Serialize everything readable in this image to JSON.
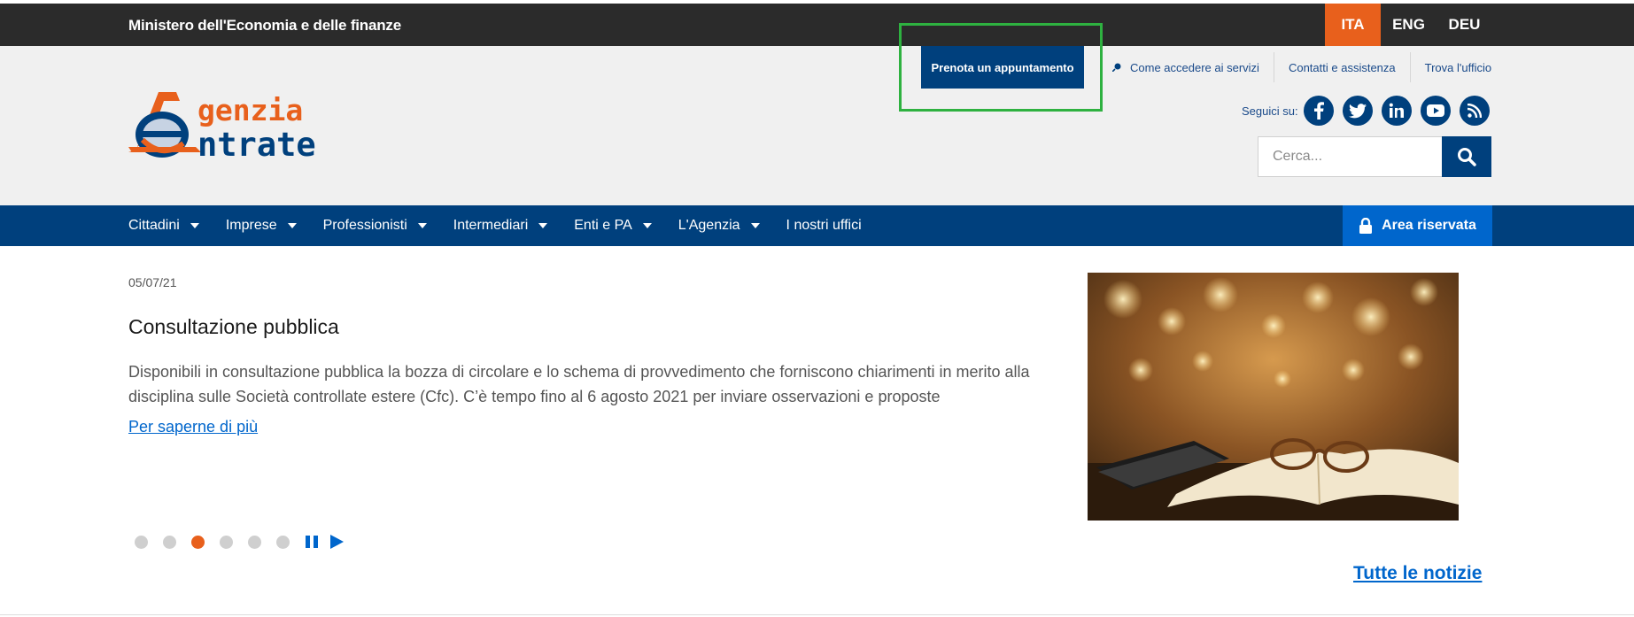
{
  "topbar": {
    "ministry": "Ministero dell'Economia e delle finanze",
    "languages": [
      {
        "label": "ITA",
        "active": true
      },
      {
        "label": "ENG",
        "active": false
      },
      {
        "label": "DEU",
        "active": false
      }
    ]
  },
  "header": {
    "logo": {
      "line1": "genzia",
      "line2": "ntrate",
      "icon": "agenzia-entrate-logo"
    },
    "prenota_label": "Prenota un appuntamento",
    "links": [
      {
        "label": "Come accedere ai servizi",
        "icon": "pin-icon"
      },
      {
        "label": "Contatti e assistenza"
      },
      {
        "label": "Trova l'ufficio"
      }
    ],
    "seguici": "Seguici su:",
    "socials": [
      "facebook-icon",
      "twitter-icon",
      "linkedin-icon",
      "youtube-icon",
      "rss-icon"
    ],
    "search_placeholder": "Cerca..."
  },
  "nav": {
    "items": [
      {
        "label": "Cittadini",
        "dropdown": true
      },
      {
        "label": "Imprese",
        "dropdown": true
      },
      {
        "label": "Professionisti",
        "dropdown": true
      },
      {
        "label": "Intermediari",
        "dropdown": true
      },
      {
        "label": "Enti e PA",
        "dropdown": true
      },
      {
        "label": "L'Agenzia",
        "dropdown": true
      },
      {
        "label": "I nostri uffici",
        "dropdown": false
      }
    ],
    "area_riservata": "Area riservata"
  },
  "news": {
    "date": "05/07/21",
    "title": "Consultazione pubblica",
    "description": "Disponibili in consultazione pubblica la bozza di circolare e lo schema di provvedimento che forniscono chiarimenti in merito alla disciplina sulle Società controllate estere (Cfc). C’è tempo fino al 6 agosto 2021 per inviare osservazioni e proposte",
    "more": "Per saperne di più",
    "image": "book-and-glasses-photo",
    "slide_count": 6,
    "active_slide": 3
  },
  "all_news": "Tutte le notizie",
  "colors": {
    "brand_blue": "#00407d",
    "accent_orange": "#e8601c",
    "link_blue": "#0066cc"
  }
}
